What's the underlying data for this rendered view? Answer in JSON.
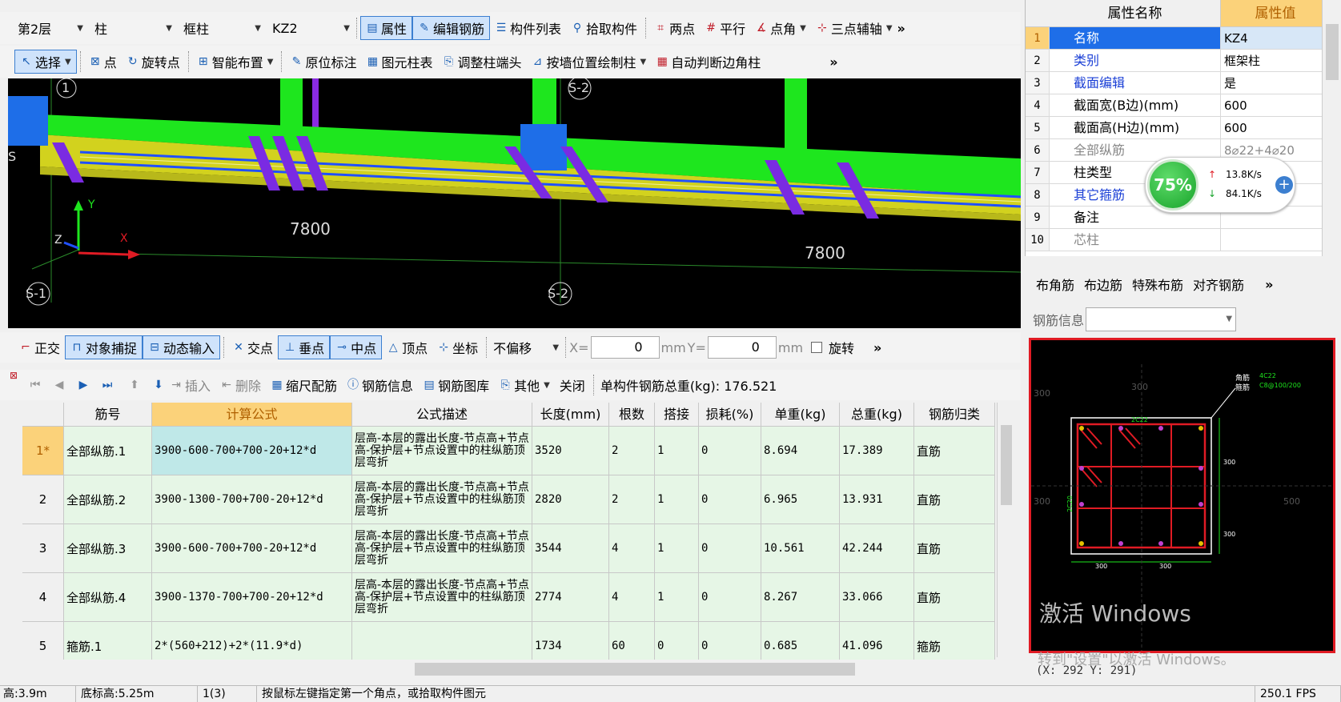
{
  "toolbar1": {
    "floor": "第2层",
    "type": "柱",
    "subtype": "框柱",
    "name": "KZ2",
    "properties": "属性",
    "edit_rebar": "编辑钢筋",
    "component_list": "构件列表",
    "pick": "拾取构件",
    "two_points": "两点",
    "parallel": "平行",
    "point_angle": "点角",
    "three_point_axis": "三点辅轴"
  },
  "toolbar2": {
    "select": "选择",
    "point": "点",
    "rotate_point": "旋转点",
    "smart_layout": "智能布置",
    "in_place": "原位标注",
    "column_table": "图元柱表",
    "adjust_head": "调整柱端头",
    "draw_by_wall": "按墙位置绘制柱",
    "auto_corner": "自动判断边角柱"
  },
  "viewport": {
    "axis_labels": [
      "1",
      "S-2",
      "S",
      "S-1",
      "S-2"
    ],
    "dims": [
      "7800",
      "7800"
    ],
    "y_axis": "Y",
    "x_axis": "X",
    "z_axis": "Z"
  },
  "snapbar": {
    "ortho": "正交",
    "snap": "对象捕捉",
    "dynamic": "动态输入",
    "intersection": "交点",
    "perpendicular": "垂点",
    "midpoint": "中点",
    "vertex": "顶点",
    "coordinate": "坐标",
    "offset": "不偏移",
    "x_label": "X=",
    "x_value": "0",
    "mm1": "mm",
    "y_label": "Y=",
    "y_value": "0",
    "mm2": "mm",
    "rotate": "旋转"
  },
  "gridbar": {
    "insert": "插入",
    "delete": "删除",
    "scale_rebar": "缩尺配筋",
    "rebar_info": "钢筋信息",
    "rebar_lib": "钢筋图库",
    "other": "其他",
    "close": "关闭",
    "total_weight": "单构件钢筋总重(kg): 176.521"
  },
  "table": {
    "headers": [
      "筋号",
      "计算公式",
      "公式描述",
      "长度(mm)",
      "根数",
      "搭接",
      "损耗(%)",
      "单重(kg)",
      "总重(kg)",
      "钢筋归类"
    ],
    "rows": [
      {
        "n": "1*",
        "name": "全部纵筋.1",
        "formula": "3900-600-700+700-20+12*d",
        "desc": "层高-本层的露出长度-节点高+节点高-保护层+节点设置中的柱纵筋顶层弯折",
        "len": "3520",
        "count": "2",
        "lap": "1",
        "loss": "0",
        "unit": "8.694",
        "total": "17.389",
        "cat": "直筋"
      },
      {
        "n": "2",
        "name": "全部纵筋.2",
        "formula": "3900-1300-700+700-20+12*d",
        "desc": "层高-本层的露出长度-节点高+节点高-保护层+节点设置中的柱纵筋顶层弯折",
        "len": "2820",
        "count": "2",
        "lap": "1",
        "loss": "0",
        "unit": "6.965",
        "total": "13.931",
        "cat": "直筋"
      },
      {
        "n": "3",
        "name": "全部纵筋.3",
        "formula": "3900-600-700+700-20+12*d",
        "desc": "层高-本层的露出长度-节点高+节点高-保护层+节点设置中的柱纵筋顶层弯折",
        "len": "3544",
        "count": "4",
        "lap": "1",
        "loss": "0",
        "unit": "10.561",
        "total": "42.244",
        "cat": "直筋"
      },
      {
        "n": "4",
        "name": "全部纵筋.4",
        "formula": "3900-1370-700+700-20+12*d",
        "desc": "层高-本层的露出长度-节点高+节点高-保护层+节点设置中的柱纵筋顶层弯折",
        "len": "2774",
        "count": "4",
        "lap": "1",
        "loss": "0",
        "unit": "8.267",
        "total": "33.066",
        "cat": "直筋"
      },
      {
        "n": "5",
        "name": "箍筋.1",
        "formula": "2*(560+212)+2*(11.9*d)",
        "desc": "",
        "len": "1734",
        "count": "60",
        "lap": "0",
        "loss": "0",
        "unit": "0.685",
        "total": "41.096",
        "cat": "箍筋"
      }
    ]
  },
  "props": {
    "header_name": "属性名称",
    "header_value": "属性值",
    "rows": [
      {
        "n": "1",
        "k": "名称",
        "v": "KZ4"
      },
      {
        "n": "2",
        "k": "类别",
        "v": "框架柱"
      },
      {
        "n": "3",
        "k": "截面编辑",
        "v": "是"
      },
      {
        "n": "4",
        "k": "截面宽(B边)(mm)",
        "v": "600"
      },
      {
        "n": "5",
        "k": "截面高(H边)(mm)",
        "v": "600"
      },
      {
        "n": "6",
        "k": "全部纵筋",
        "v": "8⌀22+4⌀20"
      },
      {
        "n": "7",
        "k": "柱类型",
        "v": ""
      },
      {
        "n": "8",
        "k": "其它箍筋",
        "v": ""
      },
      {
        "n": "9",
        "k": "备注",
        "v": ""
      },
      {
        "n": "10",
        "k": "芯柱",
        "v": ""
      }
    ]
  },
  "net_widget": {
    "percent": "75%",
    "up": "13.8K/s",
    "down": "84.1K/s"
  },
  "rebar_tools": {
    "corner": "布角筋",
    "edge": "布边筋",
    "special": "特殊布筋",
    "align": "对齐钢筋",
    "info_label": "钢筋信息"
  },
  "section": {
    "dims": [
      "300",
      "300",
      "2C22",
      "300",
      "300",
      "500",
      "2C20",
      "300",
      "300",
      "300"
    ],
    "legend1": "角筋",
    "legend2": "箍筋",
    "legend_val1": "4C22",
    "legend_val2": "C8@100/200"
  },
  "watermark": {
    "line1": "激活 Windows",
    "line2": "转到\"设置\"以激活 Windows。"
  },
  "coords": "(X: 292 Y: 291)",
  "status": {
    "height": "高:3.9m",
    "bottom": "底标高:5.25m",
    "count": "1(3)",
    "hint": "按鼠标左键指定第一个角点，或拾取构件图元",
    "fps": "250.1 FPS"
  },
  "colors": {
    "accent": "#3c7fd0",
    "table_bg": "#e6f6e6",
    "column_blue": "#1e6ee8",
    "beam_green": "#1ee61e",
    "beam_yellow": "#d2d21e"
  }
}
